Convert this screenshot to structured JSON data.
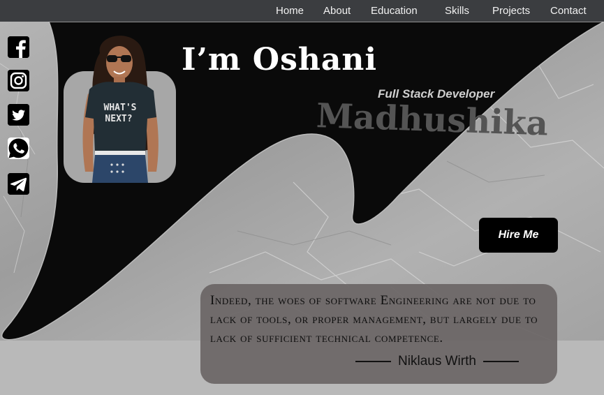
{
  "nav": {
    "items": [
      {
        "label": "Home"
      },
      {
        "label": "About"
      },
      {
        "label": "Education"
      },
      {
        "label": "Skills"
      },
      {
        "label": "Projects"
      },
      {
        "label": "Contact"
      }
    ]
  },
  "social": [
    {
      "icon": "facebook-icon"
    },
    {
      "icon": "instagram-icon"
    },
    {
      "icon": "twitter-icon"
    },
    {
      "icon": "whatsapp-icon"
    },
    {
      "icon": "telegram-icon"
    }
  ],
  "hero": {
    "first_name": "I’m Oshani",
    "role": "Full Stack Developer",
    "surname": "Madhushika",
    "hire_label": "Hire Me",
    "photo_shirt_text": "WHAT'S NEXT?"
  },
  "quote": {
    "text": "Indeed, the woes of software Engineering are not due to lack of tools, or proper management, but largely due to lack of sufficient technical competence.",
    "author": "Niklaus Wirth"
  },
  "colors": {
    "nav_bg": "#3b3d40",
    "hero_dark": "#0a0a0a",
    "marble": "#a9a9a9",
    "page_bg": "#b9b9b9",
    "quote_card": "#6a6565",
    "button": "#000000"
  }
}
